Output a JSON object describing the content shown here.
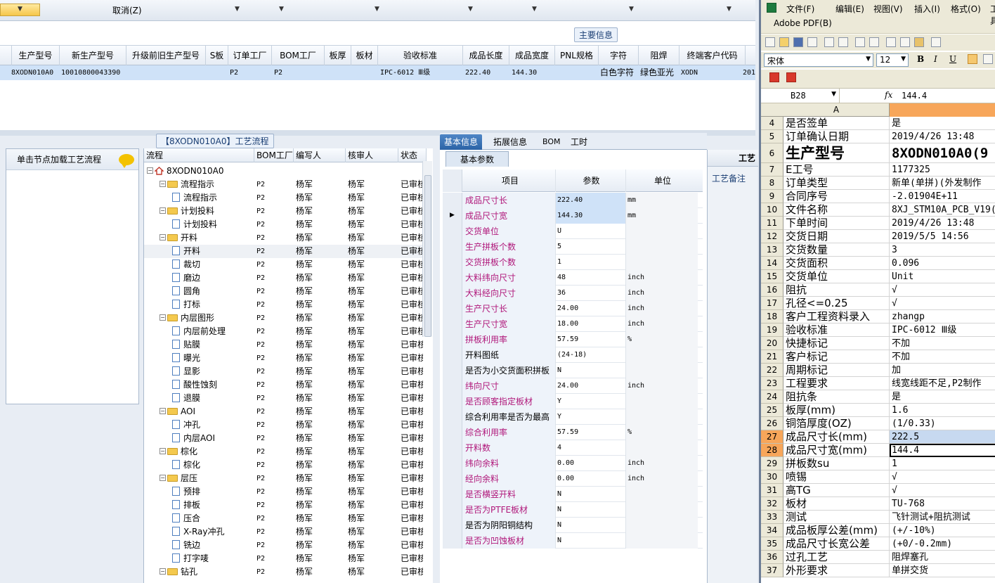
{
  "top_bar": {
    "cancel": "取消(Z)"
  },
  "main_grid": {
    "section_title": "主要信息",
    "headers": [
      "生产型号",
      "新生产型号",
      "升级前旧生产型号",
      "S板",
      "订单工厂",
      "BOM工厂",
      "板厚",
      "板材",
      "验收标准",
      "成品长度",
      "成品宽度",
      "PNL规格",
      "字符",
      "阻焊",
      "终端客户代码"
    ],
    "row": {
      "model": "8XODN010A0",
      "new_model": "10010800043390",
      "order_factory": "P2",
      "bom_factory": "P2",
      "standard": "IPC-6012 Ⅲ级",
      "length": "222.40",
      "width": "144.30",
      "char": "白色字符",
      "solder": "绿色亚光",
      "client": "XODN",
      "extra": "201"
    }
  },
  "flow_panel": {
    "title": "【8XODN010A0】工艺流程",
    "left_header": "单击节点加载工艺流程",
    "tree_headers": [
      "流程",
      "BOM工厂",
      "编写人",
      "核审人",
      "状态"
    ],
    "rows": [
      {
        "label": "8XODN010A0",
        "type": "root"
      },
      {
        "label": "流程指示",
        "type": "folder",
        "factory": "P2",
        "writer": "杨军",
        "reviewer": "杨军",
        "status": "已审核"
      },
      {
        "label": "流程指示",
        "type": "leaf",
        "factory": "P2",
        "writer": "杨军",
        "reviewer": "杨军",
        "status": "已审核"
      },
      {
        "label": "计划投料",
        "type": "folder",
        "factory": "P2",
        "writer": "杨军",
        "reviewer": "杨军",
        "status": "已审核"
      },
      {
        "label": "计划投料",
        "type": "leaf",
        "factory": "P2",
        "writer": "杨军",
        "reviewer": "杨军",
        "status": "已审核"
      },
      {
        "label": "开料",
        "type": "folder",
        "factory": "P2",
        "writer": "杨军",
        "reviewer": "杨军",
        "status": "已审核"
      },
      {
        "label": "开料",
        "type": "leaf",
        "factory": "P2",
        "writer": "杨军",
        "reviewer": "杨军",
        "status": "已审核",
        "selected": true
      },
      {
        "label": "裁切",
        "type": "leaf",
        "factory": "P2",
        "writer": "杨军",
        "reviewer": "杨军",
        "status": "已审核"
      },
      {
        "label": "磨边",
        "type": "leaf",
        "factory": "P2",
        "writer": "杨军",
        "reviewer": "杨军",
        "status": "已审核"
      },
      {
        "label": "圆角",
        "type": "leaf",
        "factory": "P2",
        "writer": "杨军",
        "reviewer": "杨军",
        "status": "已审核"
      },
      {
        "label": "打标",
        "type": "leaf",
        "factory": "P2",
        "writer": "杨军",
        "reviewer": "杨军",
        "status": "已审核"
      },
      {
        "label": "内层图形",
        "type": "folder",
        "factory": "P2",
        "writer": "杨军",
        "reviewer": "杨军",
        "status": "已审核"
      },
      {
        "label": "内层前处理",
        "type": "leaf",
        "factory": "P2",
        "writer": "杨军",
        "reviewer": "杨军",
        "status": "已审核"
      },
      {
        "label": "贴膜",
        "type": "leaf",
        "factory": "P2",
        "writer": "杨军",
        "reviewer": "杨军",
        "status": "已审核"
      },
      {
        "label": "曝光",
        "type": "leaf",
        "factory": "P2",
        "writer": "杨军",
        "reviewer": "杨军",
        "status": "已审核"
      },
      {
        "label": "显影",
        "type": "leaf",
        "factory": "P2",
        "writer": "杨军",
        "reviewer": "杨军",
        "status": "已审核"
      },
      {
        "label": "酸性蚀刻",
        "type": "leaf",
        "factory": "P2",
        "writer": "杨军",
        "reviewer": "杨军",
        "status": "已审核"
      },
      {
        "label": "退膜",
        "type": "leaf",
        "factory": "P2",
        "writer": "杨军",
        "reviewer": "杨军",
        "status": "已审核"
      },
      {
        "label": "AOI",
        "type": "folder",
        "factory": "P2",
        "writer": "杨军",
        "reviewer": "杨军",
        "status": "已审核"
      },
      {
        "label": "冲孔",
        "type": "leaf",
        "factory": "P2",
        "writer": "杨军",
        "reviewer": "杨军",
        "status": "已审核"
      },
      {
        "label": "内层AOI",
        "type": "leaf",
        "factory": "P2",
        "writer": "杨军",
        "reviewer": "杨军",
        "status": "已审核"
      },
      {
        "label": "棕化",
        "type": "folder",
        "factory": "P2",
        "writer": "杨军",
        "reviewer": "杨军",
        "status": "已审核"
      },
      {
        "label": "棕化",
        "type": "leaf",
        "factory": "P2",
        "writer": "杨军",
        "reviewer": "杨军",
        "status": "已审核"
      },
      {
        "label": "层压",
        "type": "folder",
        "factory": "P2",
        "writer": "杨军",
        "reviewer": "杨军",
        "status": "已审核"
      },
      {
        "label": "预排",
        "type": "leaf",
        "factory": "P2",
        "writer": "杨军",
        "reviewer": "杨军",
        "status": "已审核"
      },
      {
        "label": "排板",
        "type": "leaf",
        "factory": "P2",
        "writer": "杨军",
        "reviewer": "杨军",
        "status": "已审核"
      },
      {
        "label": "压合",
        "type": "leaf",
        "factory": "P2",
        "writer": "杨军",
        "reviewer": "杨军",
        "status": "已审核"
      },
      {
        "label": "X-Ray冲孔",
        "type": "leaf",
        "factory": "P2",
        "writer": "杨军",
        "reviewer": "杨军",
        "status": "已审核"
      },
      {
        "label": "铣边",
        "type": "leaf",
        "factory": "P2",
        "writer": "杨军",
        "reviewer": "杨军",
        "status": "已审核"
      },
      {
        "label": "打字唛",
        "type": "leaf",
        "factory": "P2",
        "writer": "杨军",
        "reviewer": "杨军",
        "status": "已审核"
      },
      {
        "label": "钻孔",
        "type": "folder",
        "factory": "P2",
        "writer": "杨军",
        "reviewer": "杨军",
        "status": "已审核"
      }
    ]
  },
  "basic_info": {
    "tabs": [
      "基本信息",
      "拓展信息",
      "BOM",
      "工时"
    ],
    "subtab": "基本参数",
    "headers": [
      "项目",
      "参数",
      "单位"
    ],
    "rows": [
      {
        "k": "成品尺寸长",
        "v": "222.40",
        "u": "mm",
        "pink": true,
        "hl": true
      },
      {
        "k": "成品尺寸宽",
        "v": "144.30",
        "u": "mm",
        "pink": true,
        "hl": true,
        "cur": true
      },
      {
        "k": "交货单位",
        "v": "U",
        "u": "",
        "pink": true
      },
      {
        "k": "生产拼板个数",
        "v": "5",
        "u": "",
        "pink": true
      },
      {
        "k": "交货拼板个数",
        "v": "1",
        "u": "",
        "pink": true
      },
      {
        "k": "大料纬向尺寸",
        "v": "48",
        "u": "inch",
        "pink": true
      },
      {
        "k": "大料经向尺寸",
        "v": "36",
        "u": "inch",
        "pink": true
      },
      {
        "k": "生产尺寸长",
        "v": "24.00",
        "u": "inch",
        "pink": true
      },
      {
        "k": "生产尺寸宽",
        "v": "18.00",
        "u": "inch",
        "pink": true
      },
      {
        "k": "拼板利用率",
        "v": "57.59",
        "u": "%",
        "pink": true
      },
      {
        "k": "开料图纸",
        "v": "(24-18)",
        "u": "",
        "pink": false
      },
      {
        "k": "是否为小交货面积拼板",
        "v": "N",
        "u": "",
        "pink": false
      },
      {
        "k": "纬向尺寸",
        "v": "24.00",
        "u": "inch",
        "pink": true
      },
      {
        "k": "是否顾客指定板材",
        "v": "Y",
        "u": "",
        "pink": true
      },
      {
        "k": "综合利用率是否为最高",
        "v": "Y",
        "u": "",
        "pink": false
      },
      {
        "k": "综合利用率",
        "v": "57.59",
        "u": "%",
        "pink": true
      },
      {
        "k": "开料数",
        "v": "4",
        "u": "",
        "pink": true
      },
      {
        "k": "纬向余料",
        "v": "0.00",
        "u": "inch",
        "pink": true
      },
      {
        "k": "经向余料",
        "v": "0.00",
        "u": "inch",
        "pink": true
      },
      {
        "k": "是否横竖开料",
        "v": "N",
        "u": "",
        "pink": true
      },
      {
        "k": "是否为PTFE板材",
        "v": "N",
        "u": "",
        "pink": true
      },
      {
        "k": "是否为阴阳铜结构",
        "v": "N",
        "u": "",
        "pink": false
      },
      {
        "k": "是否为凹蚀板材",
        "v": "N",
        "u": "",
        "pink": true
      }
    ]
  },
  "right_panel": {
    "tab": "工艺",
    "label": "工艺备注"
  },
  "excel": {
    "menu": [
      "文件(F)",
      "编辑(E)",
      "视图(V)",
      "插入(I)",
      "格式(O)",
      "工具"
    ],
    "pdf_label": "Adobe PDF(B)",
    "font": "宋体",
    "size": "12",
    "cell_ref": "B28",
    "fx": "fx",
    "formula": "144.4",
    "col_a": "A",
    "rows": [
      {
        "n": "4",
        "a": "是否签单",
        "b": "是"
      },
      {
        "n": "5",
        "a": "订单确认日期",
        "b": "2019/4/26 13:48"
      },
      {
        "n": "6",
        "a": "生产型号",
        "b": "8XODN010A0(9",
        "big": true
      },
      {
        "n": "7",
        "a": "E工号",
        "b": "1177325"
      },
      {
        "n": "8",
        "a": "订单类型",
        "b": "新单(单拼)(外发制作"
      },
      {
        "n": "9",
        "a": "合同序号",
        "b": "-2.01904E+11"
      },
      {
        "n": "10",
        "a": "文件名称",
        "b": "8XJ_STM10A_PCB_V19("
      },
      {
        "n": "11",
        "a": "下单时间",
        "b": "2019/4/26 13:48"
      },
      {
        "n": "12",
        "a": "交货日期",
        "b": "2019/5/5 14:56"
      },
      {
        "n": "13",
        "a": "交货数量",
        "b": "3"
      },
      {
        "n": "14",
        "a": "交货面积",
        "b": "0.096"
      },
      {
        "n": "15",
        "a": "交货单位",
        "b": "Unit"
      },
      {
        "n": "16",
        "a": "阻抗",
        "b": "√"
      },
      {
        "n": "17",
        "a": "孔径<=0.25",
        "b": "√"
      },
      {
        "n": "18",
        "a": "客户工程资料录入",
        "b": "zhangp"
      },
      {
        "n": "19",
        "a": "验收标准",
        "b": "IPC-6012 Ⅲ级"
      },
      {
        "n": "20",
        "a": "快捷标记",
        "b": "不加"
      },
      {
        "n": "21",
        "a": "客户标记",
        "b": "不加"
      },
      {
        "n": "22",
        "a": "周期标记",
        "b": "加"
      },
      {
        "n": "23",
        "a": "工程要求",
        "b": "线宽线距不足,P2制作"
      },
      {
        "n": "24",
        "a": "阻抗条",
        "b": "是"
      },
      {
        "n": "25",
        "a": "板厚(mm)",
        "b": "1.6"
      },
      {
        "n": "26",
        "a": "铜箔厚度(OZ)",
        "b": "(1/0.33)"
      },
      {
        "n": "27",
        "a": "成品尺寸长(mm)",
        "b": "222.5",
        "sel": true
      },
      {
        "n": "28",
        "a": "成品尺寸宽(mm)",
        "b": "144.4",
        "sel": true,
        "active": true
      },
      {
        "n": "29",
        "a": "拼板数su",
        "b": "1"
      },
      {
        "n": "30",
        "a": "喷锡",
        "b": "√"
      },
      {
        "n": "31",
        "a": "高TG",
        "b": "√"
      },
      {
        "n": "32",
        "a": "板材",
        "b": "TU-768"
      },
      {
        "n": "33",
        "a": "测试",
        "b": "飞针测试+阻抗测试"
      },
      {
        "n": "34",
        "a": "成品板厚公差(mm)",
        "b": "(+/-10%)"
      },
      {
        "n": "35",
        "a": "成品尺寸长宽公差",
        "b": "(+0/-0.2mm)"
      },
      {
        "n": "36",
        "a": "过孔工艺",
        "b": "阻焊塞孔"
      },
      {
        "n": "37",
        "a": "外形要求",
        "b": "单拼交货"
      }
    ]
  },
  "colors": {
    "pink": "#b0177a",
    "sel_blue": "#cfe2f8",
    "excel_sel": "#c7d9f0",
    "excel_row_sel": "#f7a65a",
    "tab_active": "#2b63a6"
  }
}
